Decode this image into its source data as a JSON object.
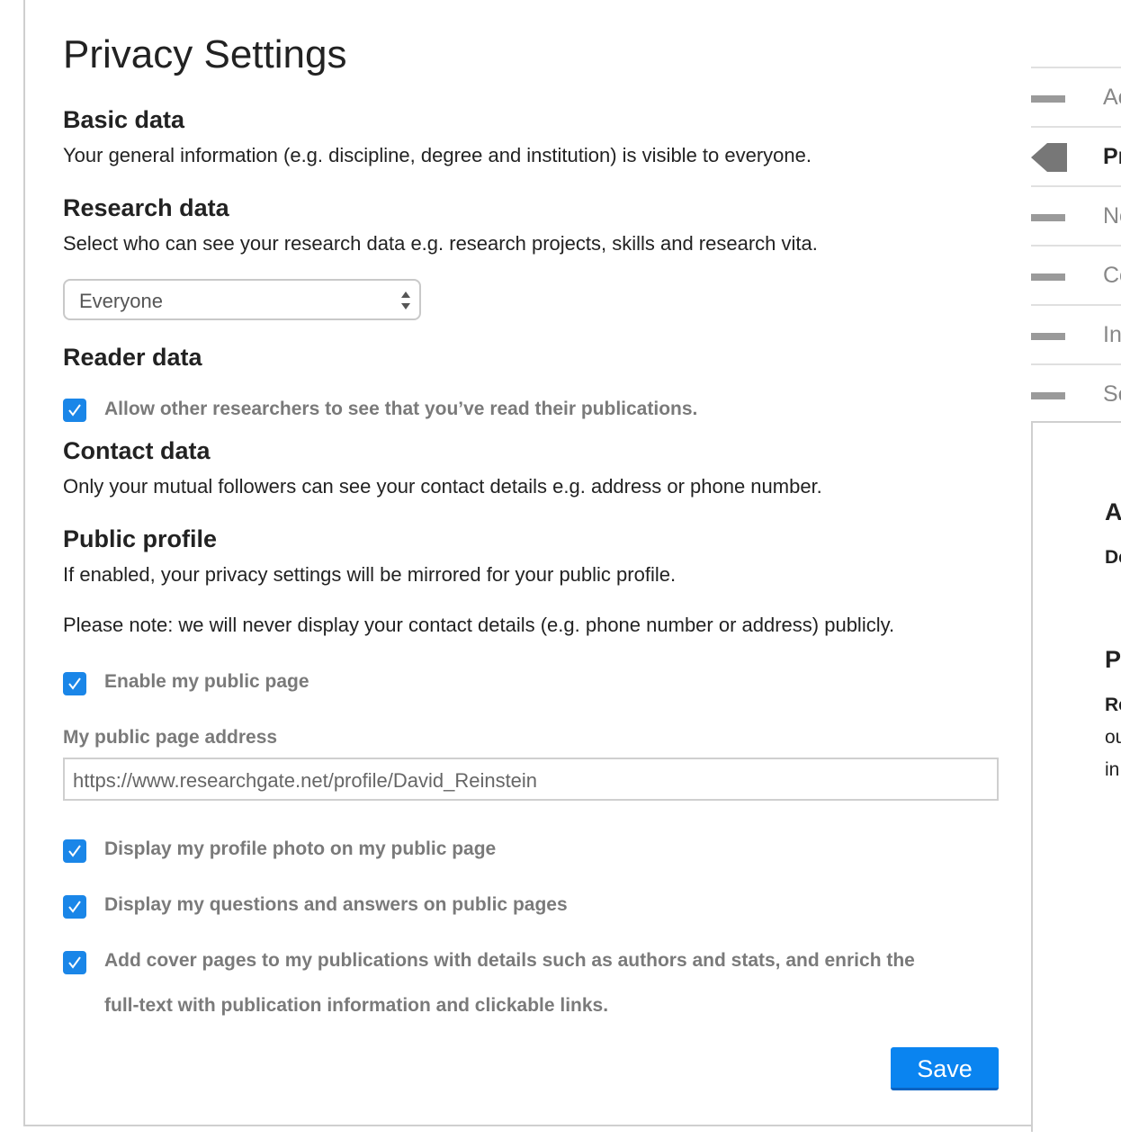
{
  "page": {
    "title": "Privacy Settings"
  },
  "basic": {
    "title": "Basic data",
    "text": "Your general information (e.g. discipline, degree and institution) is visible to everyone."
  },
  "research": {
    "title": "Research data",
    "text": "Select who can see your research data e.g. research projects, skills and research vita.",
    "select_value": "Everyone"
  },
  "reader": {
    "title": "Reader data",
    "checkbox_label": "Allow other researchers to see that you’ve read their publications.",
    "checked": true
  },
  "contact": {
    "title": "Contact data",
    "text": "Only your mutual followers can see your contact details e.g. address or phone number."
  },
  "public_profile": {
    "title": "Public profile",
    "text": "If enabled, your privacy settings will be mirrored for your public profile.",
    "note": "Please note: we will never display your contact details (e.g. phone number or address) publicly.",
    "enable_label": "Enable my public page",
    "address_label": "My public page address",
    "address_value": "https://www.researchgate.net/profile/David_Reinstein",
    "photo_label": "Display my profile photo on my public page",
    "qa_label": "Display my questions and answers on public pages",
    "cover_label_line1": "Add cover pages to my publications with details such as authors and stats, and enrich the",
    "cover_label_line2": "full-text with publication information and clickable links."
  },
  "actions": {
    "save_label": "Save"
  },
  "sidebar": {
    "items": [
      {
        "label": "Ac",
        "active": false
      },
      {
        "label": "Pr",
        "active": true
      },
      {
        "label": "No",
        "active": false
      },
      {
        "label": "Co",
        "active": false
      },
      {
        "label": "In",
        "active": false
      },
      {
        "label": "Se",
        "active": false
      }
    ],
    "box": {
      "heading1": "A",
      "sub1": "De",
      "heading2": "P",
      "sub2": "Re",
      "line1": "ou",
      "line2": "in"
    }
  },
  "colors": {
    "accent": "#0a84f0",
    "checkbox": "#1a86e8"
  }
}
